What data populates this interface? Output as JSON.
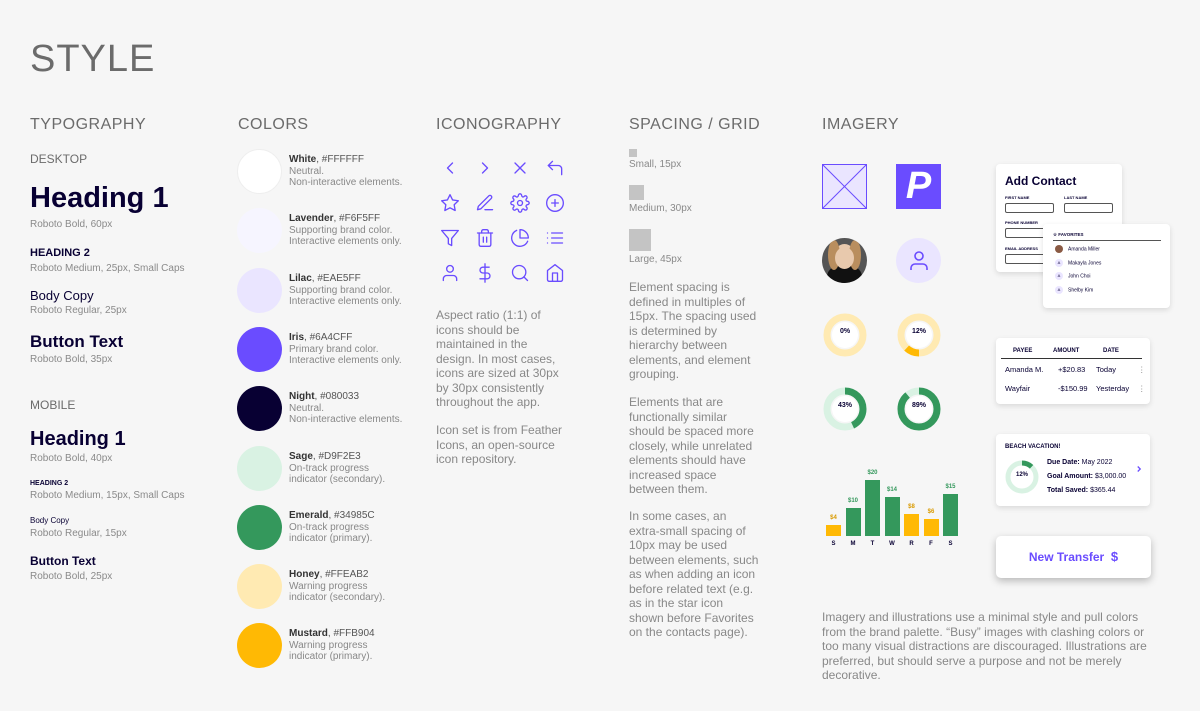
{
  "page": {
    "title": "STYLE"
  },
  "typography": {
    "heading": "TYPOGRAPHY",
    "desktop": "DESKTOP",
    "mobile": "MOBILE",
    "d_h1": "Heading 1",
    "d_h1_cap": "Roboto Bold, 60px",
    "d_h2": "HEADING 2",
    "d_h2_cap": "Roboto Medium, 25px, Small Caps",
    "d_body": "Body Copy",
    "d_body_cap": "Roboto Regular, 25px",
    "d_btn": "Button Text",
    "d_btn_cap": "Roboto Bold, 35px",
    "m_h1": "Heading 1",
    "m_h1_cap": "Roboto Bold, 40px",
    "m_h2": "HEADING 2",
    "m_h2_cap": "Roboto Medium, 15px, Small Caps",
    "m_body": "Body Copy",
    "m_body_cap": "Roboto Regular, 15px",
    "m_btn": "Button Text",
    "m_btn_cap": "Roboto Bold, 25px"
  },
  "colors": {
    "heading": "COLORS",
    "items": [
      {
        "name": "White",
        "hex": "#FFFFFF",
        "d1": "Neutral.",
        "d2": "Non-interactive elements."
      },
      {
        "name": "Lavender",
        "hex": "#F6F5FF",
        "d1": "Supporting brand color.",
        "d2": "Interactive elements only."
      },
      {
        "name": "Lilac",
        "hex": "#EAE5FF",
        "d1": "Supporting brand color.",
        "d2": "Interactive elements only."
      },
      {
        "name": "Iris",
        "hex": "#6A4CFF",
        "d1": "Primary brand color.",
        "d2": "Interactive elements only."
      },
      {
        "name": "Night",
        "hex": "#080033",
        "d1": "Neutral.",
        "d2": "Non-interactive elements."
      },
      {
        "name": "Sage",
        "hex": "#D9F2E3",
        "d1": "On-track progress",
        "d2": "indicator (secondary)."
      },
      {
        "name": "Emerald",
        "hex": "#34985C",
        "d1": "On-track progress",
        "d2": "indicator (primary)."
      },
      {
        "name": "Honey",
        "hex": "#FFEAB2",
        "d1": "Warning progress",
        "d2": "indicator (secondary)."
      },
      {
        "name": "Mustard",
        "hex": "#FFB904",
        "d1": "Warning progress",
        "d2": "indicator (primary)."
      }
    ]
  },
  "iconography": {
    "heading": "ICONOGRAPHY",
    "p1": [
      "Aspect ratio (1:1) of",
      "icons should be",
      "maintained in the",
      "design. In most cases,",
      "icons are sized at 30px",
      "by 30px consistently",
      "throughout the app."
    ],
    "p2": [
      "Icon set is from Feather",
      "Icons, an open-source",
      "icon repository."
    ]
  },
  "spacing": {
    "heading": "SPACING / GRID",
    "small": "Small, 15px",
    "medium": "Medium, 30px",
    "large": "Large, 45px",
    "p1": [
      "Element spacing is",
      "defined in multiples of",
      "15px. The spacing used",
      "is determined by",
      "hierarchy between",
      "elements, and element",
      "grouping."
    ],
    "p2": [
      "Elements that are",
      "functionally similar",
      "should be spaced more",
      "closely, while unrelated",
      "elements should have",
      "increased space",
      "between them."
    ],
    "p3": [
      "In some cases, an",
      "extra-small spacing of",
      "10px may be used",
      "between elements, such",
      "as when adding an icon",
      "before related text (e.g.",
      "as in the star icon",
      "shown before Favorites",
      "on the contacts page)."
    ]
  },
  "imagery": {
    "heading": "IMAGERY",
    "logo": "P",
    "donuts": [
      "0%",
      "12%",
      "43%",
      "89%"
    ],
    "chart": {
      "values": [
        "$4",
        "$10",
        "$20",
        "$14",
        "$8",
        "$6",
        "$15"
      ],
      "days": [
        "S",
        "M",
        "T",
        "W",
        "R",
        "F",
        "S"
      ]
    },
    "para": [
      "Imagery and illustrations use a minimal style and pull colors",
      "from the brand palette. “Busy” images with clashing colors or",
      "too many visual distractions are discouraged. Illustrations are",
      "preferred, but should serve a purpose and not be merely",
      "decorative."
    ]
  },
  "addContact": {
    "title": "Add Contact",
    "first": "FIRST NAME",
    "last": "LAST NAME",
    "phone": "PHONE NUMBER",
    "email": "EMAIL ADDRESS"
  },
  "favorites": {
    "label": "☆ FAVORITES",
    "items": [
      "Amanda Miller",
      "Makayla Jones",
      "John Choi",
      "Shelby Kim"
    ],
    "initial": "A"
  },
  "payees": {
    "h_payee": "PAYEE",
    "h_amount": "AMOUNT",
    "h_date": "DATE",
    "rows": [
      {
        "payee": "Amanda M.",
        "amount": "+$20.83",
        "date": "Today"
      },
      {
        "payee": "Wayfair",
        "amount": "-$150.99",
        "date": "Yesterday"
      }
    ]
  },
  "goal": {
    "title": "BEACH VACATION!",
    "pct": "12%",
    "due_l": "Due Date:",
    "due_v": "May 2022",
    "amt_l": "Goal Amount:",
    "amt_v": "$3,000.00",
    "saved_l": "Total Saved:",
    "saved_v": "$365.44"
  },
  "transfer": {
    "label": "New Transfer",
    "icon": "$"
  }
}
